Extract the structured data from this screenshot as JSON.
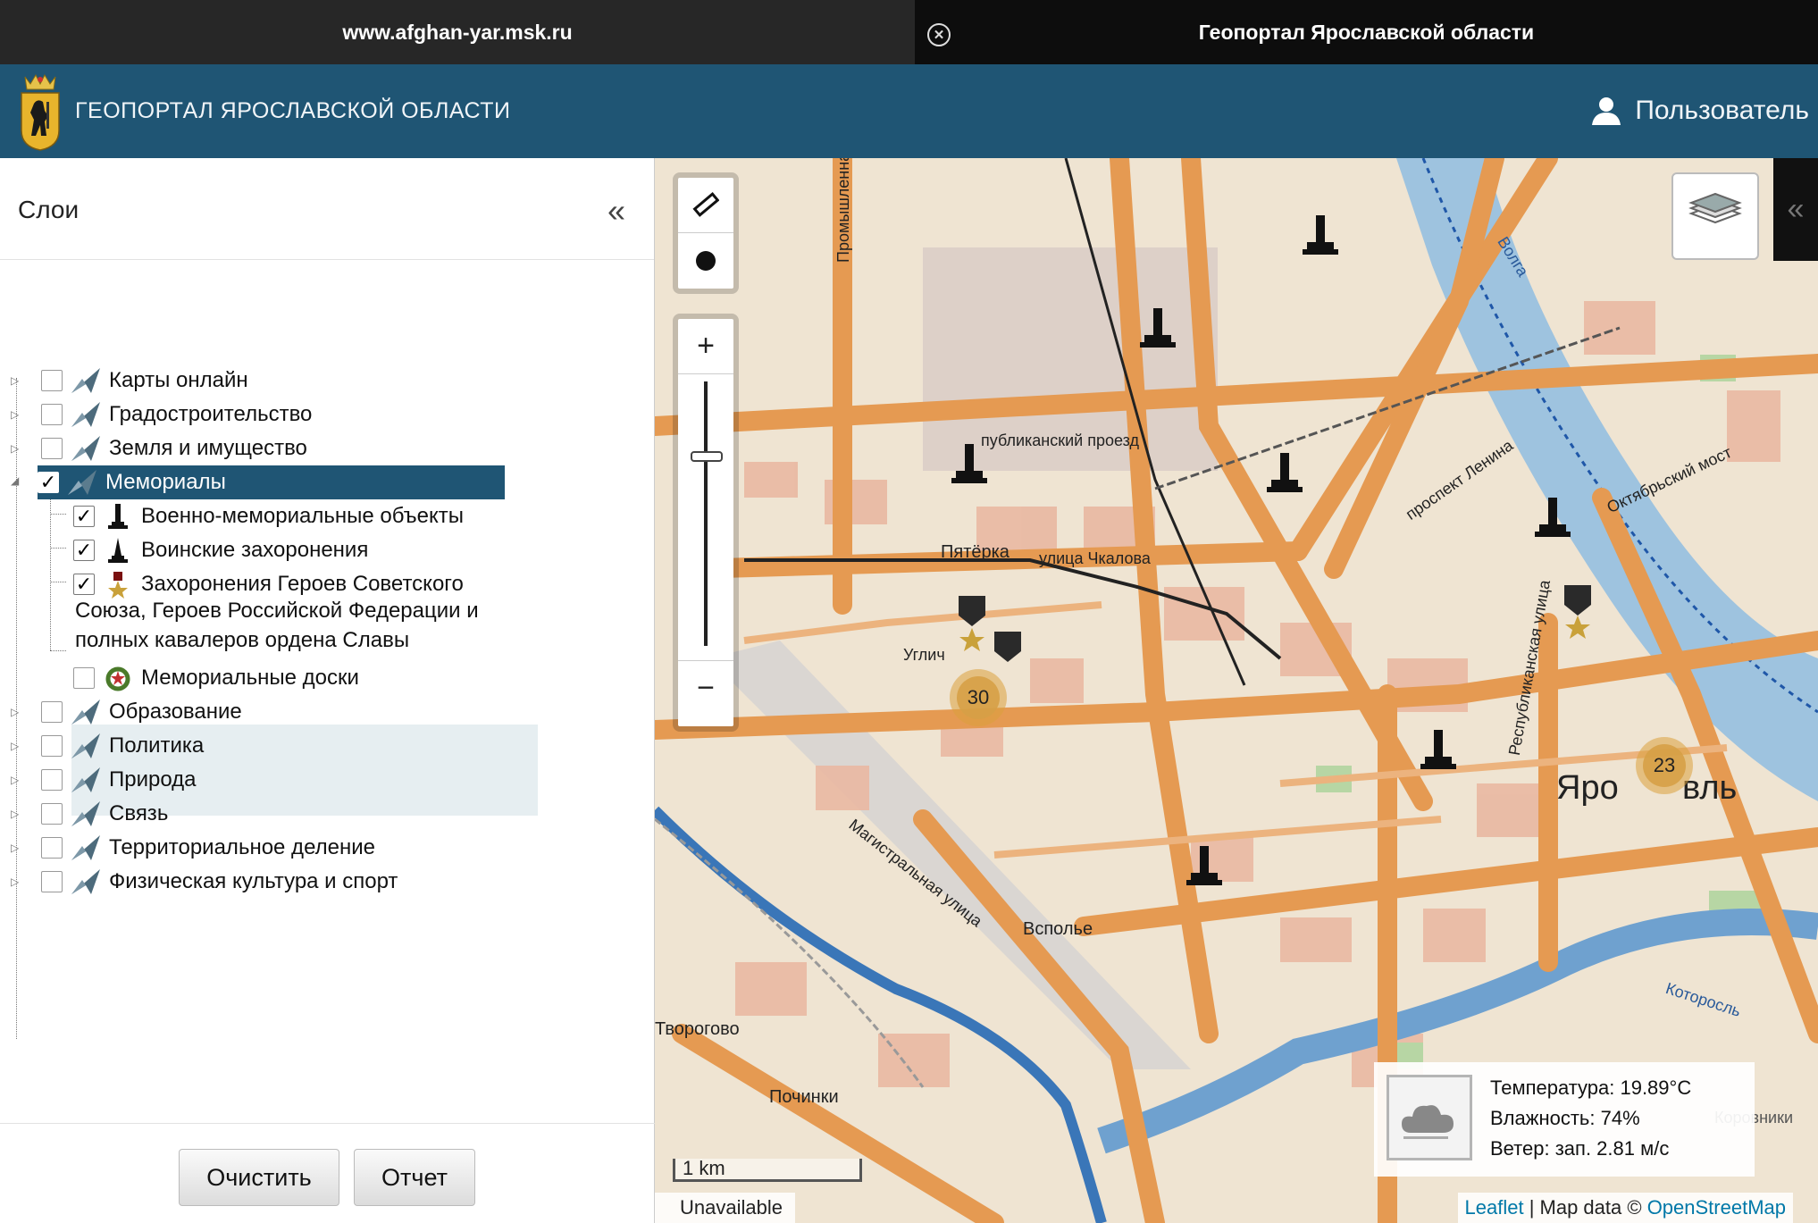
{
  "browser": {
    "tab_left": "www.afghan-yar.msk.ru",
    "tab_right": "Геопортал Ярославской области"
  },
  "header": {
    "title": "ГЕОПОРТАЛ ЯРОСЛАВСКОЙ ОБЛАСТИ",
    "user": "Пользователь"
  },
  "sidebar": {
    "title": "Слои",
    "layers": [
      {
        "label": "Карты онлайн",
        "checked": false
      },
      {
        "label": "Градостроительство",
        "checked": false
      },
      {
        "label": "Земля и имущество",
        "checked": false
      },
      {
        "label": "Мемориалы",
        "checked": true,
        "selected": true
      },
      {
        "label": "Военно-мемориальные объекты",
        "checked": true
      },
      {
        "label": "Воинские захоронения",
        "checked": true
      },
      {
        "label": "Захоронения Героев Советского",
        "checked": true
      },
      {
        "label": "Мемориальные доски",
        "checked": false
      },
      {
        "label": "Образование",
        "checked": false
      },
      {
        "label": "Политика",
        "checked": false
      },
      {
        "label": "Природа",
        "checked": false
      },
      {
        "label": "Связь",
        "checked": false
      },
      {
        "label": "Территориальное деление",
        "checked": false
      },
      {
        "label": "Физическая культура и спорт",
        "checked": false
      }
    ],
    "multiline_rest": "Союза, Героев Российской Федерации и полных кавалеров ордена Славы",
    "btn_clear": "Очистить",
    "btn_report": "Отчет"
  },
  "map": {
    "labels": {
      "republican": "публиканский проезд",
      "pyaterka": "Пятёрка",
      "chkalova": "улица Чкалова",
      "lenina": "проспект Ленина",
      "utlich": "Углич",
      "magistral": "Магистральная улица",
      "vspolye": "Всполье",
      "tvorogovo": "Творогово",
      "pochinki": "Починки",
      "yaroslavl_a": "Яро",
      "yaroslavl_b": "вль",
      "korovniki": "Коровники",
      "volga": "Волга",
      "oktyabr": "Октябрьский мост",
      "respublikanskaya": "Республиканская улица",
      "promyshlennaya": "Промышленная",
      "korotorosl": "Которосль"
    },
    "clusters": [
      {
        "count": "30"
      },
      {
        "count": "23"
      }
    ],
    "zoom_in": "+",
    "zoom_out": "−",
    "scale": "1 km",
    "unavailable": "Unavailable",
    "attribution_leaflet": "Leaflet",
    "attribution_sep": " | Map data © ",
    "attribution_osm": "OpenStreetMap",
    "weather": {
      "temperature": "Температура: 19.89°C",
      "humidity": "Влажность: 74%",
      "wind": "Ветер: зап. 2.81 м/с"
    }
  }
}
